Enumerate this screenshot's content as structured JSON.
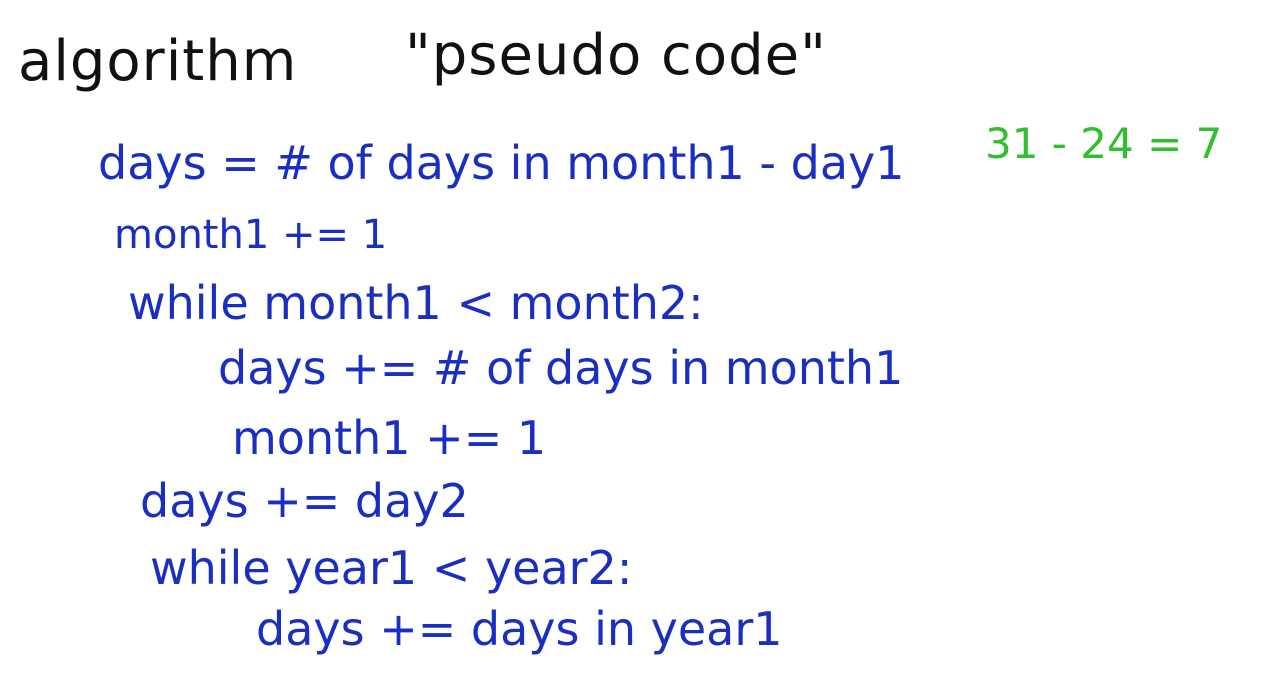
{
  "heading": {
    "left": "algorithm",
    "right": "\"pseudo code\""
  },
  "code_lines": [
    "days = # of days in month1 - day1",
    "month1 += 1",
    "while month1 < month2:",
    "days += # of days in month1",
    "month1 += 1",
    "days += day2",
    "while year1 < year2:",
    "days += days in year1"
  ],
  "note": "31 - 24 = 7",
  "colors": {
    "heading": "#111111",
    "code": "#1a2fc2",
    "note": "#2fbf2f",
    "background": "#ffffff"
  }
}
